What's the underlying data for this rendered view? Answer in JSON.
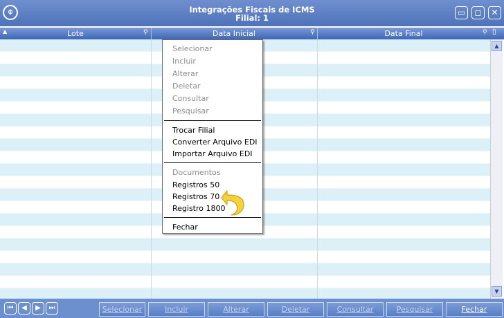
{
  "window": {
    "title_line1": "Integrações Fiscais de ICMS",
    "title_line2": "Filial: 1",
    "controls": [
      "▭",
      "◻",
      "✕"
    ]
  },
  "grid": {
    "columns": [
      "Lote",
      "Data Inicial",
      "Data Final"
    ]
  },
  "context_menu": {
    "group1": [
      "Selecionar",
      "Incluir",
      "Alterar",
      "Deletar",
      "Consultar",
      "Pesquisar"
    ],
    "group2": [
      "Trocar Filial",
      "Converter Arquivo EDI",
      "Importar Arquivo EDI"
    ],
    "group3_header": "Documentos",
    "group3": [
      "Registros 50",
      "Registros 70",
      "Registro 1800"
    ],
    "group4": [
      "Fechar"
    ]
  },
  "footer": {
    "nav": [
      "⏮",
      "◀",
      "▶",
      "⏭"
    ],
    "buttons": [
      "Selecionar",
      "Incluir",
      "Alterar",
      "Deletar",
      "Consultar",
      "Pesquisar",
      "Fechar"
    ]
  },
  "colors": {
    "title_bar": "#5a7bc0",
    "header": "#4a6fbe",
    "row_alt": "#dcf0f8",
    "pointer": "#f4d23a"
  }
}
